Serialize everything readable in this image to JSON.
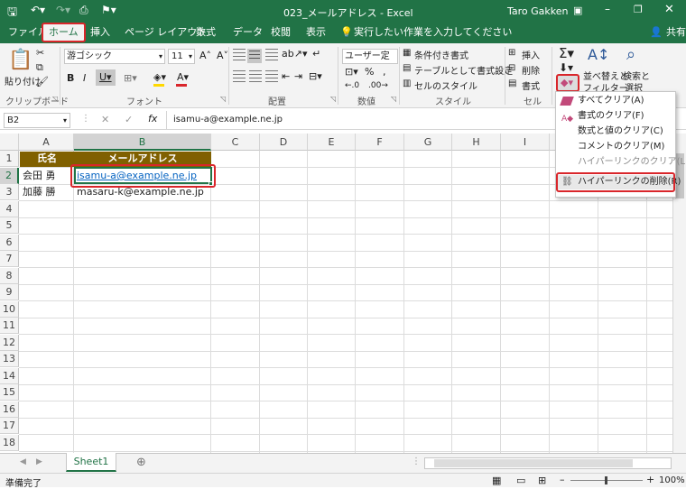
{
  "window": {
    "title": "023_メールアドレス - Excel",
    "user": "Taro Gakken"
  },
  "tabs": [
    "ファイル",
    "ホーム",
    "挿入",
    "ページ レイアウト",
    "数式",
    "データ",
    "校閲",
    "表示"
  ],
  "tell_me": "実行したい作業を入力してください",
  "share": "共有",
  "ribbon": {
    "paste": "貼り付け",
    "font_name": "游ゴシック",
    "font_size": "11",
    "number_format": "ユーザー定義",
    "cond_format": "条件付き書式",
    "table_format": "テーブルとして書式設定",
    "cell_style": "セルのスタイル",
    "insert": "挿入",
    "delete": "削除",
    "format": "書式",
    "sort_filter_1": "並べ替えと",
    "sort_filter_2": "フィルター",
    "find_select_1": "検索と",
    "find_select_2": "選択",
    "groups": {
      "clipboard": "クリップボード",
      "font": "フォント",
      "alignment": "配置",
      "number": "数値",
      "styles": "スタイル",
      "cells": "セル"
    }
  },
  "formula_bar": {
    "name_box": "B2",
    "content": "isamu-a@example.ne.jp"
  },
  "columns": [
    "A",
    "B",
    "C",
    "D",
    "E",
    "F",
    "G",
    "H",
    "I"
  ],
  "rows": [
    "1",
    "2",
    "3",
    "4",
    "5",
    "6",
    "7",
    "8",
    "9",
    "10",
    "11",
    "12",
    "13",
    "14",
    "15",
    "16",
    "17",
    "18"
  ],
  "cells": {
    "A1": "氏名",
    "B1": "メールアドレス",
    "A2": "会田 勇",
    "B2": "isamu-a@example.ne.jp",
    "A3": "加藤 勝",
    "B3": "masaru-k@example.ne.jp"
  },
  "clear_menu": [
    "すべてクリア(A)",
    "書式のクリア(F)",
    "数式と値のクリア(C)",
    "コメントのクリア(M)",
    "ハイパーリンクのクリア(L)",
    "ハイパーリンクの削除(R)"
  ],
  "sheet_tab": "Sheet1",
  "status": {
    "ready": "準備完了",
    "zoom": "100%"
  },
  "colors": {
    "excel_green": "#217346",
    "header_fill": "#806000",
    "highlight": "#d9262b",
    "link": "#0563c1"
  }
}
